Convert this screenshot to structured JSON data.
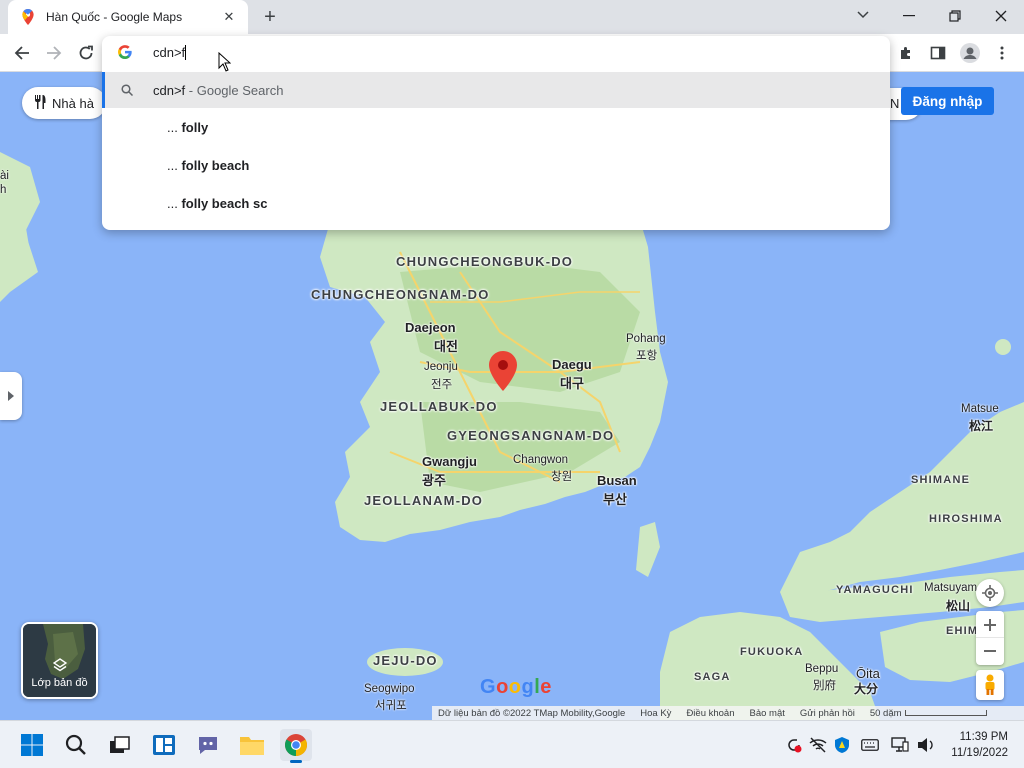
{
  "browser": {
    "tab_title": "Hàn Quốc - Google Maps",
    "tab_close": "✕",
    "new_tab": "+",
    "omnibox_text": "cdn>f"
  },
  "dropdown": {
    "selected_query": "cdn>f",
    "selected_suffix": " - Google Search",
    "suggestions": [
      {
        "prefix": "... ",
        "bold": "folly"
      },
      {
        "prefix": "... ",
        "bold": "folly beach"
      },
      {
        "prefix": "... ",
        "bold": "folly beach sc"
      }
    ]
  },
  "maps": {
    "chip_restaurants": "Nhà hà",
    "chip_right": "TN",
    "signin_label": "Đăng nhập",
    "layers_label": "Lớp bản đồ",
    "google_logo": "Google",
    "attribution": [
      "Dữ liệu bản đồ ©2022 TMap Mobility,Google",
      "Hoa Kỳ",
      "Điều khoản",
      "Bảo mật",
      "Gửi phản hồi",
      "50 dặm"
    ],
    "edge_label_1": "ài",
    "edge_label_2": "h",
    "regions": {
      "chungcheongbuk": "CHUNGCHEONGBUK-DO",
      "chungcheongnam": "CHUNGCHEONGNAM-DO",
      "jeollabuk": "JEOLLABUK-DO",
      "gyeongsangnam": "GYEONGSANGNAM-DO",
      "jeollanam": "JEOLLANAM-DO",
      "jeju": "JEJU-DO",
      "shimane": "SHIMANE",
      "hiroshima": "HIROSHIMA",
      "yamaguchi": "YAMAGUCHI",
      "ehime": "EHIM",
      "fukuoka": "FUKUOKA",
      "saga": "SAGA"
    },
    "cities": {
      "daejeon": "Daejeon",
      "daejeon_ko": "대전",
      "jeonju": "Jeonju",
      "jeonju_ko": "전주",
      "daegu": "Daegu",
      "daegu_ko": "대구",
      "pohang": "Pohang",
      "pohang_ko": "포항",
      "gwangju": "Gwangju",
      "gwangju_ko": "광주",
      "changwon": "Changwon",
      "changwon_ko": "창원",
      "busan": "Busan",
      "busan_ko": "부산",
      "seogwipo": "Seogwipo",
      "seogwipo_ko": "서귀포",
      "matsue": "Matsue",
      "matsue_ko": "松江",
      "matsuyama": "Matsuyam",
      "matsuyama_ko": "松山",
      "beppu": "Beppu",
      "beppu_ko": "別府",
      "oita": "Ōita",
      "oita_ko": "大分"
    }
  },
  "taskbar": {
    "time": "11:39 PM",
    "date": "11/19/2022"
  },
  "colors": {
    "water": "#8ab4f8",
    "land": "#cfe8c2",
    "accent": "#1a73e8",
    "pin": "#ea4335"
  }
}
